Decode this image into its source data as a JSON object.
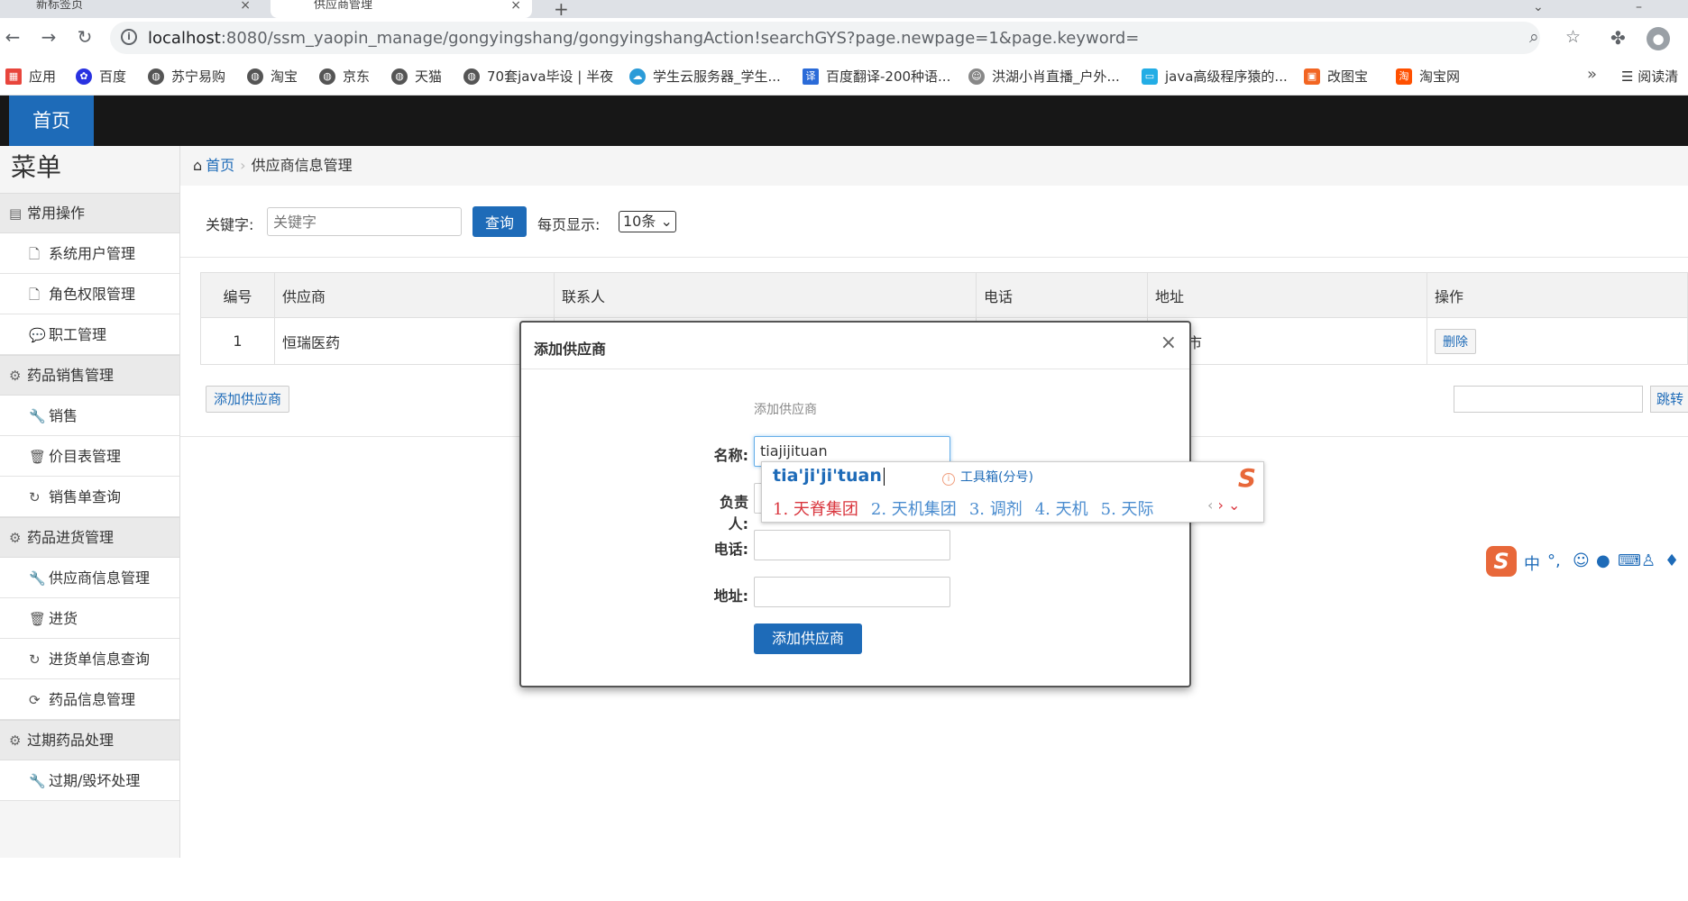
{
  "browser": {
    "tabs": [
      {
        "title": "新标签页",
        "active": false
      },
      {
        "title": "供应商管理",
        "active": true
      }
    ],
    "url_host": "localhost",
    "url_path": ":8080/ssm_yaopin_manage/gongyingshang/gongyingshangAction!searchGYS?page.newpage=1&page.keyword=",
    "bookmarks": [
      {
        "label": "应用",
        "icon": "apps-grid-icon",
        "color": "#e8453c"
      },
      {
        "label": "百度",
        "icon": "baidu-paw-icon",
        "color": "#2932e1"
      },
      {
        "label": "苏宁易购",
        "icon": "globe-icon",
        "color": "#555555"
      },
      {
        "label": "淘宝",
        "icon": "globe-icon",
        "color": "#555555"
      },
      {
        "label": "京东",
        "icon": "globe-icon",
        "color": "#555555"
      },
      {
        "label": "天猫",
        "icon": "globe-icon",
        "color": "#555555"
      },
      {
        "label": "70套java毕设 | 半夜",
        "icon": "globe-icon",
        "color": "#555555"
      },
      {
        "label": "学生云服务器_学生...",
        "icon": "cloud-icon",
        "color": "#2b9bd8"
      },
      {
        "label": "百度翻译-200种语...",
        "icon": "translate-icon",
        "color": "#2b6bd8"
      },
      {
        "label": "洪湖小肖直播_户外...",
        "icon": "avatar-icon",
        "color": "#888888"
      },
      {
        "label": "java高级程序猿的...",
        "icon": "bilibili-icon",
        "color": "#23ade5"
      },
      {
        "label": "改图宝",
        "icon": "image-icon",
        "color": "#f26522"
      },
      {
        "label": "淘宝网",
        "icon": "taobao-icon",
        "color": "#ff5000"
      }
    ],
    "bookmarks_more": "»",
    "reading_list": "阅读清"
  },
  "app": {
    "home_tab": "首页",
    "menu_title": "菜单",
    "menu": [
      {
        "group": "常用操作",
        "icon": "book-icon",
        "items": [
          {
            "label": "系统用户管理",
            "icon": "file-icon"
          },
          {
            "label": "角色权限管理",
            "icon": "file-icon"
          },
          {
            "label": "职工管理",
            "icon": "comment-icon"
          }
        ]
      },
      {
        "group": "药品销售管理",
        "icon": "gear-icon",
        "items": [
          {
            "label": "销售",
            "icon": "wrench-icon"
          },
          {
            "label": "价目表管理",
            "icon": "trash-icon"
          },
          {
            "label": "销售单查询",
            "icon": "refresh-icon"
          }
        ]
      },
      {
        "group": "药品进货管理",
        "icon": "gear-icon",
        "items": [
          {
            "label": "供应商信息管理",
            "icon": "wrench-icon"
          },
          {
            "label": "进货",
            "icon": "trash-icon"
          },
          {
            "label": "进货单信息查询",
            "icon": "refresh-icon"
          },
          {
            "label": "药品信息管理",
            "icon": "sync-icon"
          }
        ]
      },
      {
        "group": "过期药品处理",
        "icon": "gear-icon",
        "items": [
          {
            "label": "过期/毁坏处理",
            "icon": "wrench-icon"
          }
        ]
      }
    ],
    "breadcrumb": {
      "home": "首页",
      "current": "供应商信息管理"
    },
    "search": {
      "keyword_label": "关键字:",
      "keyword_placeholder": "关键字",
      "query_button": "查询",
      "page_size_label": "每页显示:",
      "page_size_value": "10条"
    },
    "table": {
      "headers": [
        "编号",
        "供应商",
        "联系人",
        "电话",
        "地址",
        "操作"
      ],
      "rows": [
        {
          "id": "1",
          "supplier": "恒瑞医药",
          "contact": "",
          "phone": "",
          "address": "市",
          "action": "删除"
        }
      ]
    },
    "add_supplier_button": "添加供应商",
    "jump_button": "跳转"
  },
  "modal": {
    "title": "添加供应商",
    "close": "×",
    "subtitle": "添加供应商",
    "fields": [
      {
        "label": "名称:",
        "value": "tiajijituan"
      },
      {
        "label": "负责人:",
        "value": ""
      },
      {
        "label": "电话:",
        "value": ""
      },
      {
        "label": "地址:",
        "value": ""
      }
    ],
    "submit": "添加供应商"
  },
  "ime": {
    "composition": "tia'ji'ji'tuan",
    "toolbox": "工具箱(分号)",
    "candidates": [
      "1. 天脊集团",
      "2. 天机集团",
      "3. 调剂",
      "4. 天机",
      "5. 天际"
    ],
    "logo": "S",
    "status_bar": {
      "mode": "中",
      "punct": "°,"
    }
  }
}
